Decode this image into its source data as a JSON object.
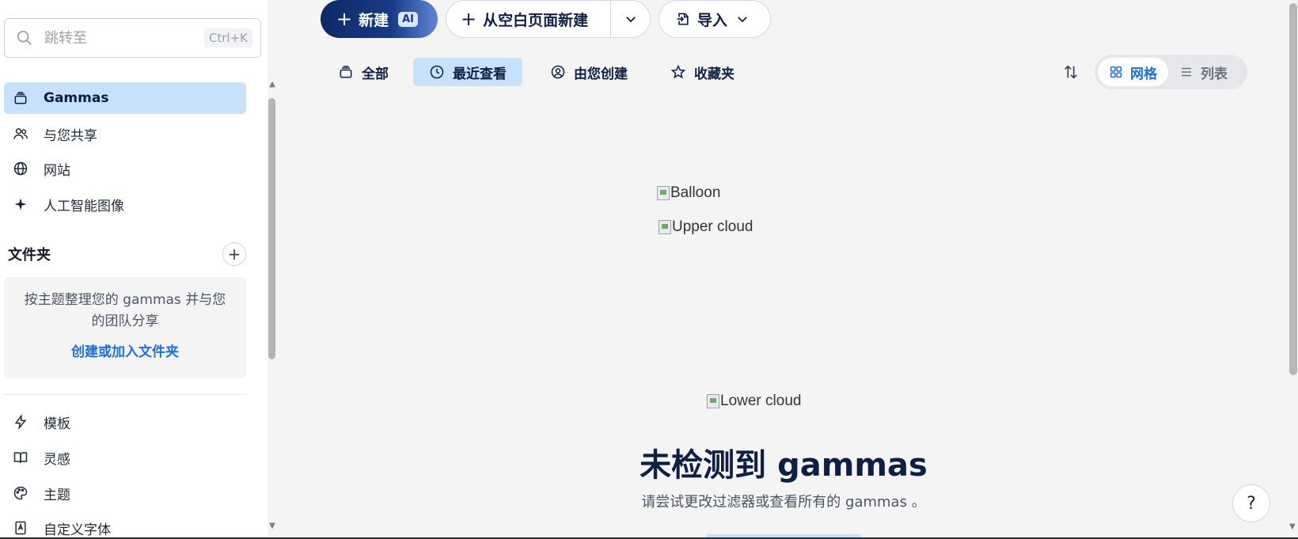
{
  "sidebar": {
    "search": {
      "placeholder": "跳转至",
      "shortcut": "Ctrl+K"
    },
    "nav": [
      {
        "label": "Gammas",
        "icon": "stack-icon",
        "active": true
      },
      {
        "label": "与您共享",
        "icon": "users-icon",
        "active": false
      },
      {
        "label": "网站",
        "icon": "globe-icon",
        "active": false
      },
      {
        "label": "人工智能图像",
        "icon": "sparkle-icon",
        "active": false
      }
    ],
    "folders": {
      "title": "文件夹",
      "description": "按主题整理您的 gammas 并与您的团队分享",
      "link": "创建或加入文件夹"
    },
    "bottom_nav": [
      {
        "label": "模板",
        "icon": "bolt-icon"
      },
      {
        "label": "灵感",
        "icon": "book-icon"
      },
      {
        "label": "主题",
        "icon": "palette-icon"
      },
      {
        "label": "自定义字体",
        "icon": "font-book-icon"
      }
    ]
  },
  "toolbar": {
    "new_label": "新建",
    "ai_badge": "AI",
    "blank_label": "从空白页面新建",
    "import_label": "导入"
  },
  "tabs": [
    {
      "label": "全部",
      "icon": "cards-icon",
      "active": false
    },
    {
      "label": "最近查看",
      "icon": "clock-icon",
      "active": true
    },
    {
      "label": "由您创建",
      "icon": "user-circle-icon",
      "active": false
    },
    {
      "label": "收藏夹",
      "icon": "star-icon",
      "active": false
    }
  ],
  "view": {
    "grid_label": "网格",
    "list_label": "列表",
    "selected": "grid"
  },
  "empty_state": {
    "balloon_alt": "Balloon",
    "upper_cloud_alt": "Upper cloud",
    "lower_cloud_alt": "Lower cloud",
    "title": "未检测到 gammas",
    "subtitle": "请尝试更改过滤器或查看所有的 gammas 。"
  },
  "help_label": "?",
  "colors": {
    "accent": "#1a6fe5",
    "active_bg": "#c7e0fb",
    "navy": "#0f1f45"
  }
}
